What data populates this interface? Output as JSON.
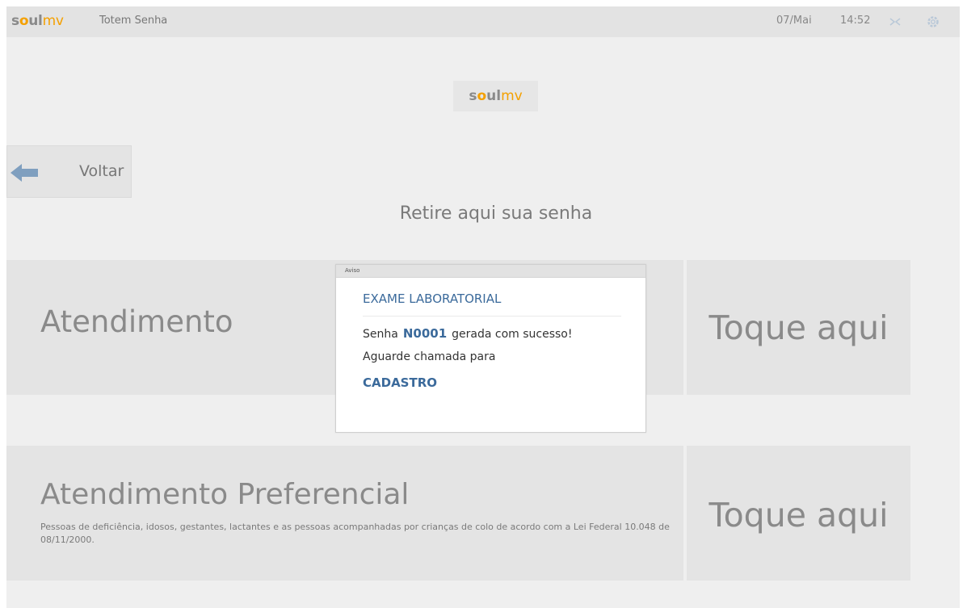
{
  "header": {
    "brand_soul_s": "s",
    "brand_soul_o": "o",
    "brand_soul_ul": "ul",
    "brand_mv": "mv",
    "title": "Totem Senha",
    "date": "07/Mai",
    "time": "14:52",
    "network_icon": "network-icon",
    "settings_icon": "gear-icon"
  },
  "center_logo": {
    "soul_s": "s",
    "soul_o": "o",
    "soul_ul": "ul",
    "mv": "mv"
  },
  "back": {
    "label": "Voltar",
    "icon": "arrow-left-icon"
  },
  "subtitle": "Retire aqui sua senha",
  "options": [
    {
      "title": "Atendimento",
      "action": "Toque aqui"
    },
    {
      "title": "Atendimento Preferencial",
      "description": "Pessoas de deficiência, idosos, gestantes, lactantes e as pessoas acompanhadas por crianças de colo de acordo com a Lei Federal 10.048 de 08/11/2000.",
      "action": "Toque aqui"
    }
  ],
  "dialog": {
    "header": "Aviso",
    "exam": "EXAME LABORATORIAL",
    "senha_prefix": "Senha",
    "ticket": "N0001",
    "senha_suffix": "gerada com sucesso!",
    "wait_text": "Aguarde chamada para",
    "sector": "CADASTRO"
  },
  "colors": {
    "brand_orange": "#f4a000",
    "accent_blue": "#3b6a9b",
    "arrow_blue": "#7f9fbf"
  }
}
